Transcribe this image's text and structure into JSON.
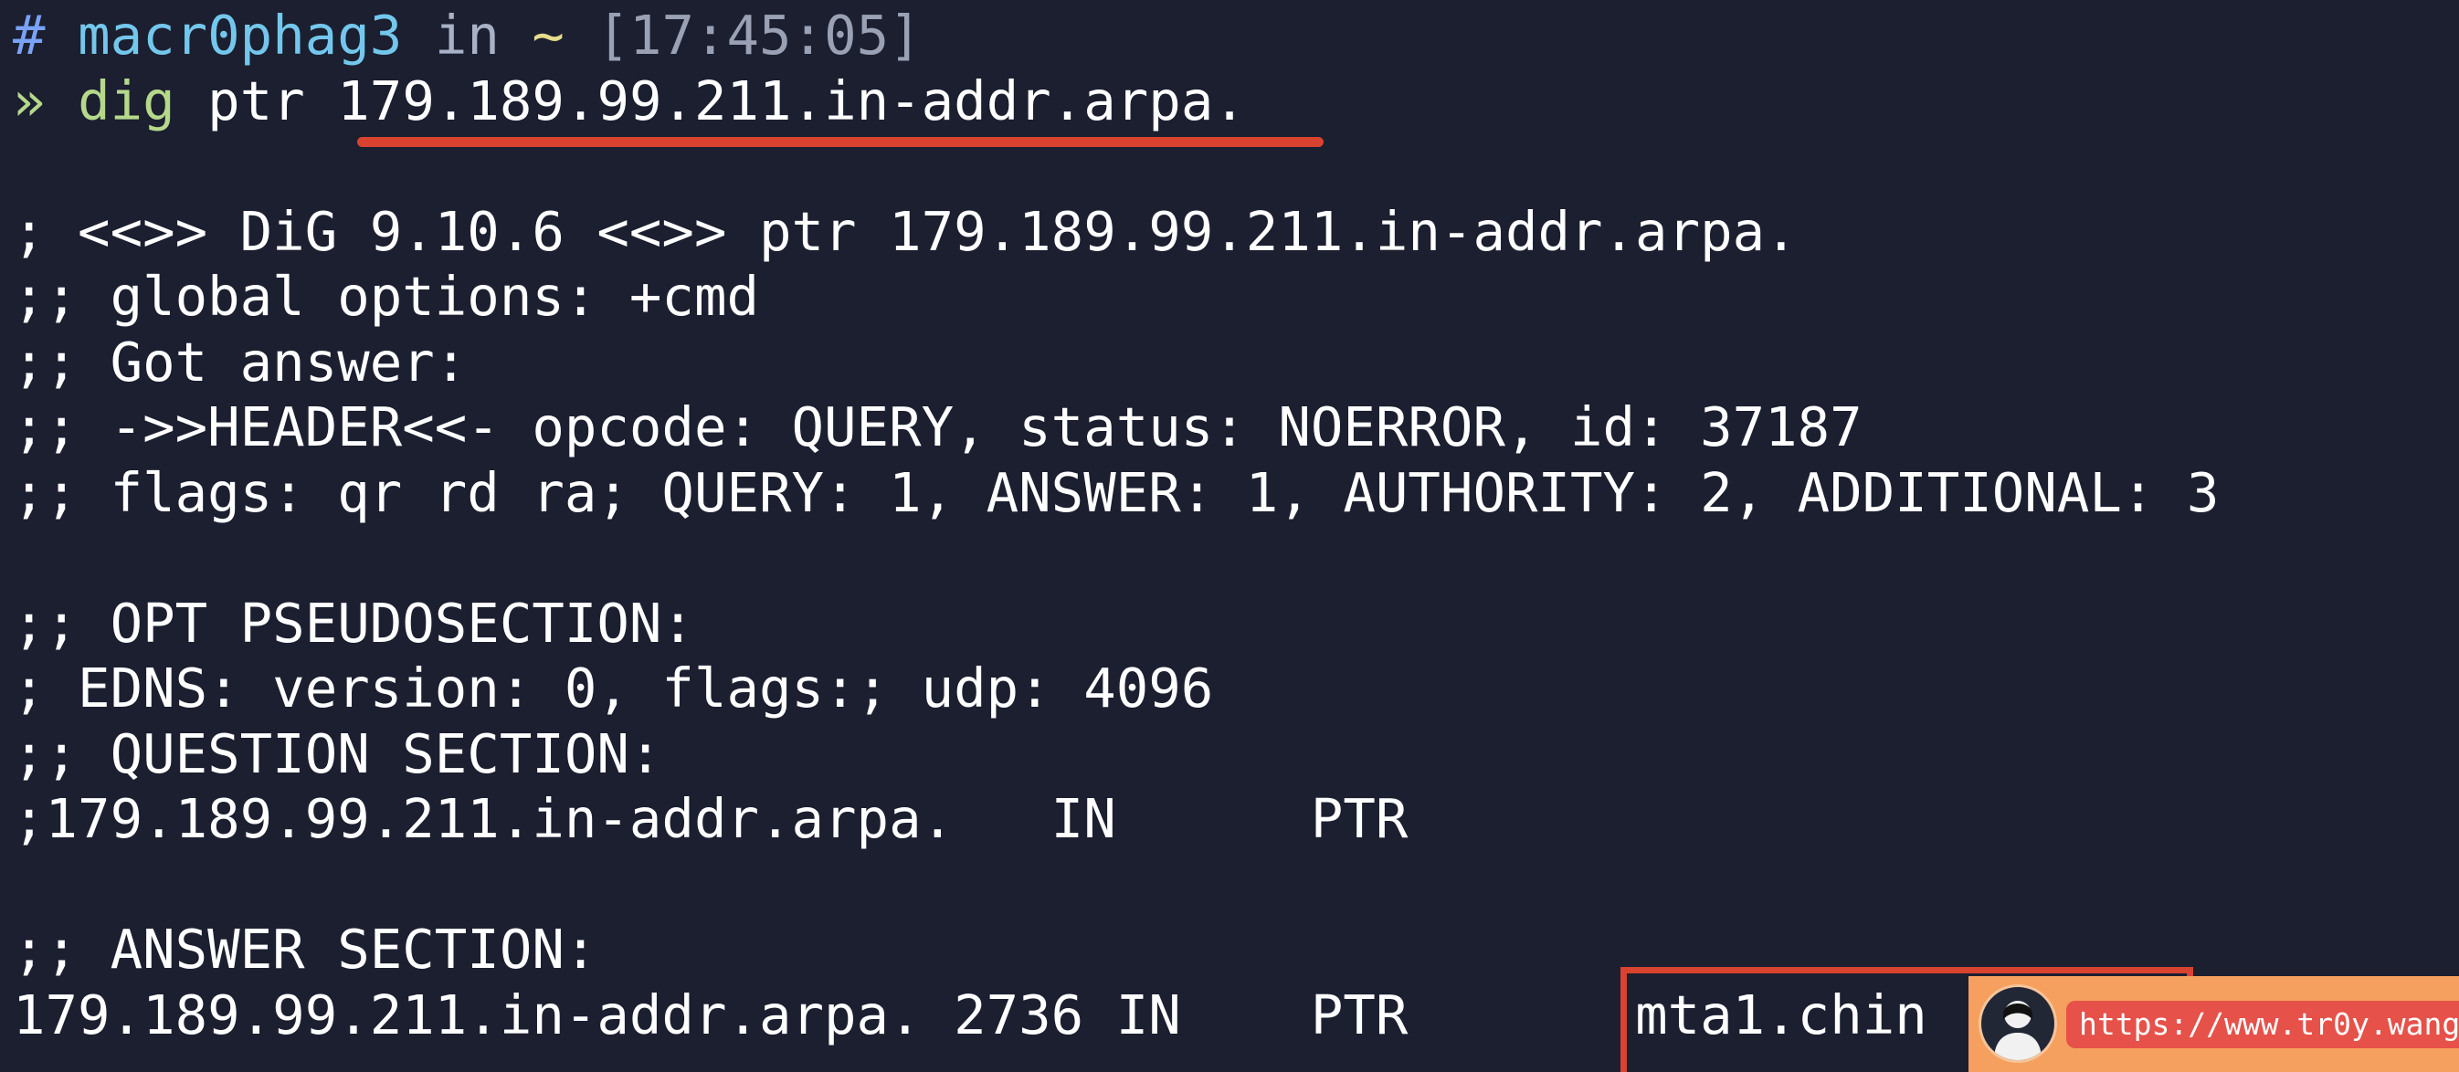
{
  "prompt": {
    "hash": "#",
    "user": "macr0phag3",
    "in": "in",
    "dir": "~",
    "time": "[17:45:05]"
  },
  "command": {
    "arrow": "»",
    "program": "dig",
    "args": "ptr",
    "target": "179.189.99.211.in-addr.arpa."
  },
  "output": {
    "l1": "; <<>> DiG 9.10.6 <<>> ptr 179.189.99.211.in-addr.arpa.",
    "l2": ";; global options: +cmd",
    "l3": ";; Got answer:",
    "l4": ";; ->>HEADER<<- opcode: QUERY, status: NOERROR, id: 37187",
    "l5": ";; flags: qr rd ra; QUERY: 1, ANSWER: 1, AUTHORITY: 2, ADDITIONAL: 3",
    "l6": ";; OPT PSEUDOSECTION:",
    "l7": "; EDNS: version: 0, flags:; udp: 4096",
    "l8": ";; QUESTION SECTION:",
    "l9": ";179.189.99.211.in-addr.arpa.   IN      PTR",
    "l10": ";; ANSWER SECTION:",
    "l11": "179.189.99.211.in-addr.arpa. 2736 IN    PTR     ",
    "answer_value": "mta1.chin"
  },
  "watermark": {
    "url": "https://www.tr0y.wang"
  },
  "colors": {
    "background": "#1b1f30",
    "highlight_red": "#d8432f",
    "watermark_orange": "#f5a05e",
    "badge_red": "#e6514a"
  }
}
